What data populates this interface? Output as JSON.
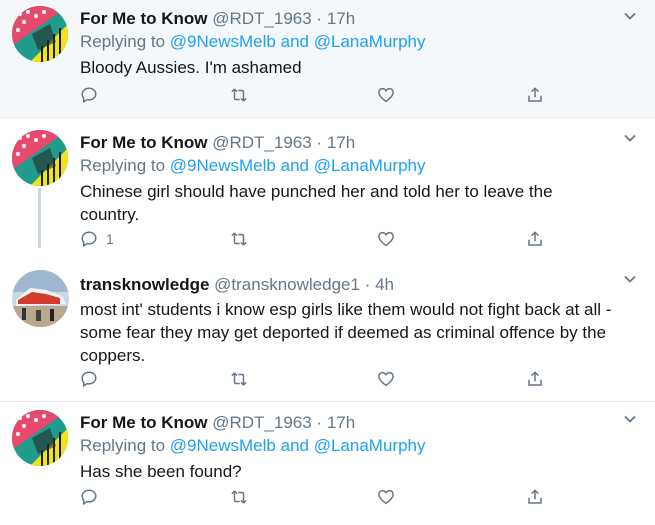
{
  "tweets": [
    {
      "name": "For Me to Know",
      "handle": "@RDT_1963",
      "dot": "·",
      "time": "17h",
      "replying_prefix": "Replying to",
      "mention1": "@9NewsMelb",
      "and": "and",
      "mention2": "@LanaMurphy",
      "text": "Bloody Aussies.  I'm ashamed",
      "reply_count": ""
    },
    {
      "name": "For Me to Know",
      "handle": "@RDT_1963",
      "dot": "·",
      "time": "17h",
      "replying_prefix": "Replying to",
      "mention1": "@9NewsMelb",
      "and": "and",
      "mention2": "@LanaMurphy",
      "text": "Chinese girl should have punched her and told her to leave the country.",
      "reply_count": "1"
    },
    {
      "name": "transknowledge",
      "handle": "@transknowledge1",
      "dot": "·",
      "time": "4h",
      "text": "most int' students i know esp girls like them would not fight back at all - some fear they may get deported if deemed as criminal offence by the coppers.",
      "reply_count": ""
    },
    {
      "name": "For Me to Know",
      "handle": "@RDT_1963",
      "dot": "·",
      "time": "17h",
      "replying_prefix": "Replying to",
      "mention1": "@9NewsMelb",
      "and": "and",
      "mention2": "@LanaMurphy",
      "text": "Has she been found?",
      "reply_count": ""
    }
  ],
  "icons": {
    "reply": "reply-icon",
    "retweet": "retweet-icon",
    "like": "heart-icon",
    "share": "share-icon",
    "caret": "chevron-down-icon"
  },
  "colors": {
    "link": "#1da1f2",
    "muted": "#657786",
    "text": "#14171a",
    "highlight_bg": "#f5f8fa"
  }
}
